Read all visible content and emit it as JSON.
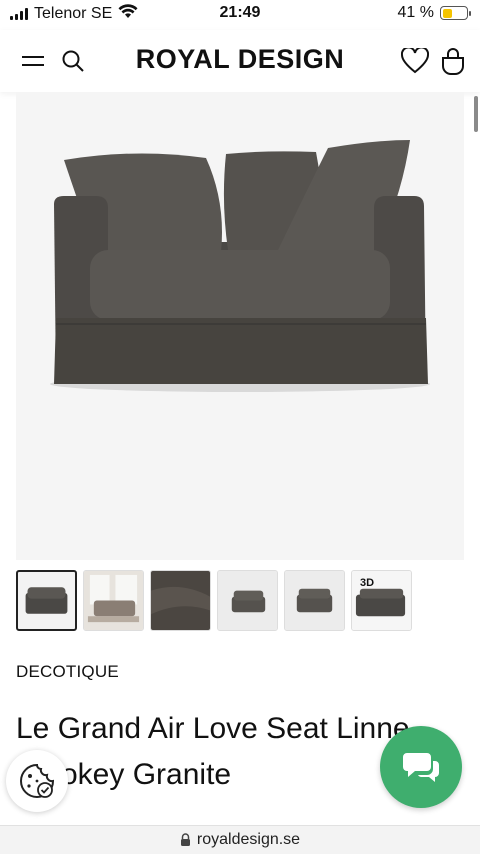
{
  "status_bar": {
    "carrier": "Telenor SE",
    "time": "21:49",
    "battery_percent": "41 %",
    "battery_level": 0.41,
    "battery_color": "#f5c400"
  },
  "header": {
    "logo": "ROYAL DESIGN",
    "icons": [
      "menu-icon",
      "search-icon",
      "heart-icon",
      "bag-icon"
    ]
  },
  "gallery": {
    "thumbnail_count": 6,
    "thumb_3d_label": "3D"
  },
  "product": {
    "brand": "DECOTIQUE",
    "title": "Le Grand Air Love Seat Linne, Smokey Granite"
  },
  "chat": {
    "color": "#3fae6e",
    "icon": "chat-icon"
  },
  "cookie": {
    "icon": "cookie-icon"
  },
  "url_bar": {
    "domain": "royaldesign.se",
    "icon": "lock-icon"
  }
}
